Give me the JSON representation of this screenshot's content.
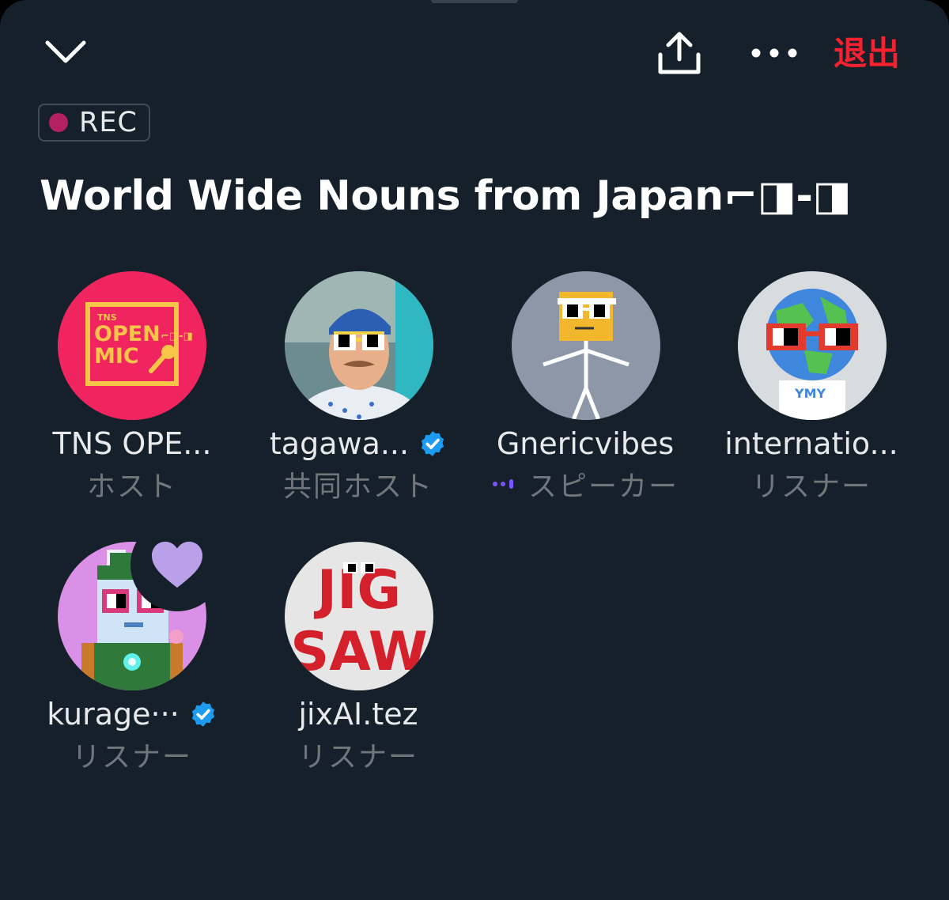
{
  "header": {
    "exit_label": "退出"
  },
  "rec_badge": {
    "label": "REC"
  },
  "space_title": "World Wide Nouns from Japan⌐◨-◨",
  "participants": [
    {
      "name": "TNS OPE...",
      "role": "ホスト",
      "verified": false,
      "avatar_text_1": "TNS",
      "avatar_text_2": "OPEN",
      "avatar_text_3": "MIC",
      "avatar_text_4": "⌐◨-◨"
    },
    {
      "name": "tagawa...",
      "role": "共同ホスト",
      "verified": true
    },
    {
      "name": "Gnericvibes",
      "role": "スピーカー",
      "verified": false,
      "speaking": true
    },
    {
      "name": "internatio...",
      "role": "リスナー",
      "verified": false
    },
    {
      "name": "kurage···",
      "role": "リスナー",
      "verified": true,
      "reaction": "heart-icon"
    },
    {
      "name": "jixAI.tez",
      "role": "リスナー",
      "verified": false,
      "avatar_text_1": "JIG",
      "avatar_text_2": "SAW"
    }
  ],
  "colors": {
    "background": "#15202b",
    "exit": "#f4212e",
    "rec_dot": "#b4215f",
    "verified": "#1d9bf0",
    "speaking": "#7856ff",
    "reaction_heart": "#b9a0e8"
  }
}
